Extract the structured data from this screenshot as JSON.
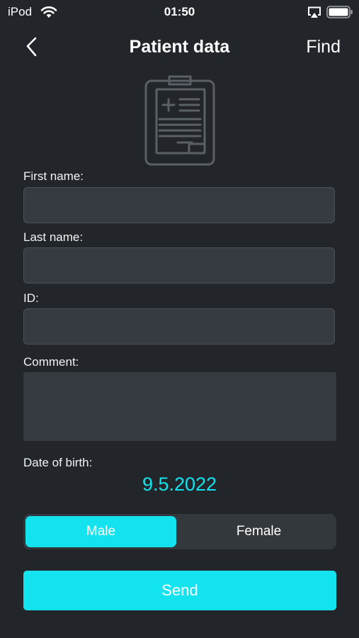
{
  "status_bar": {
    "carrier": "iPod",
    "time": "01:50"
  },
  "nav": {
    "title": "Patient data",
    "find_label": "Find"
  },
  "form": {
    "first_name_label": "First name:",
    "first_name_value": "",
    "last_name_label": "Last name:",
    "last_name_value": "",
    "id_label": "ID:",
    "id_value": "",
    "comment_label": "Comment:",
    "comment_value": "",
    "dob_label": "Date of birth:",
    "dob_value": "9.5.2022"
  },
  "gender": {
    "options": [
      "Male",
      "Female"
    ],
    "selected": "Male"
  },
  "send_label": "Send",
  "colors": {
    "background": "#22262b",
    "accent": "#13e3ee",
    "field_background": "#363b41"
  },
  "icons": [
    "wifi-icon",
    "airplay-icon",
    "battery-icon",
    "back-chevron-icon",
    "clipboard-icon"
  ]
}
